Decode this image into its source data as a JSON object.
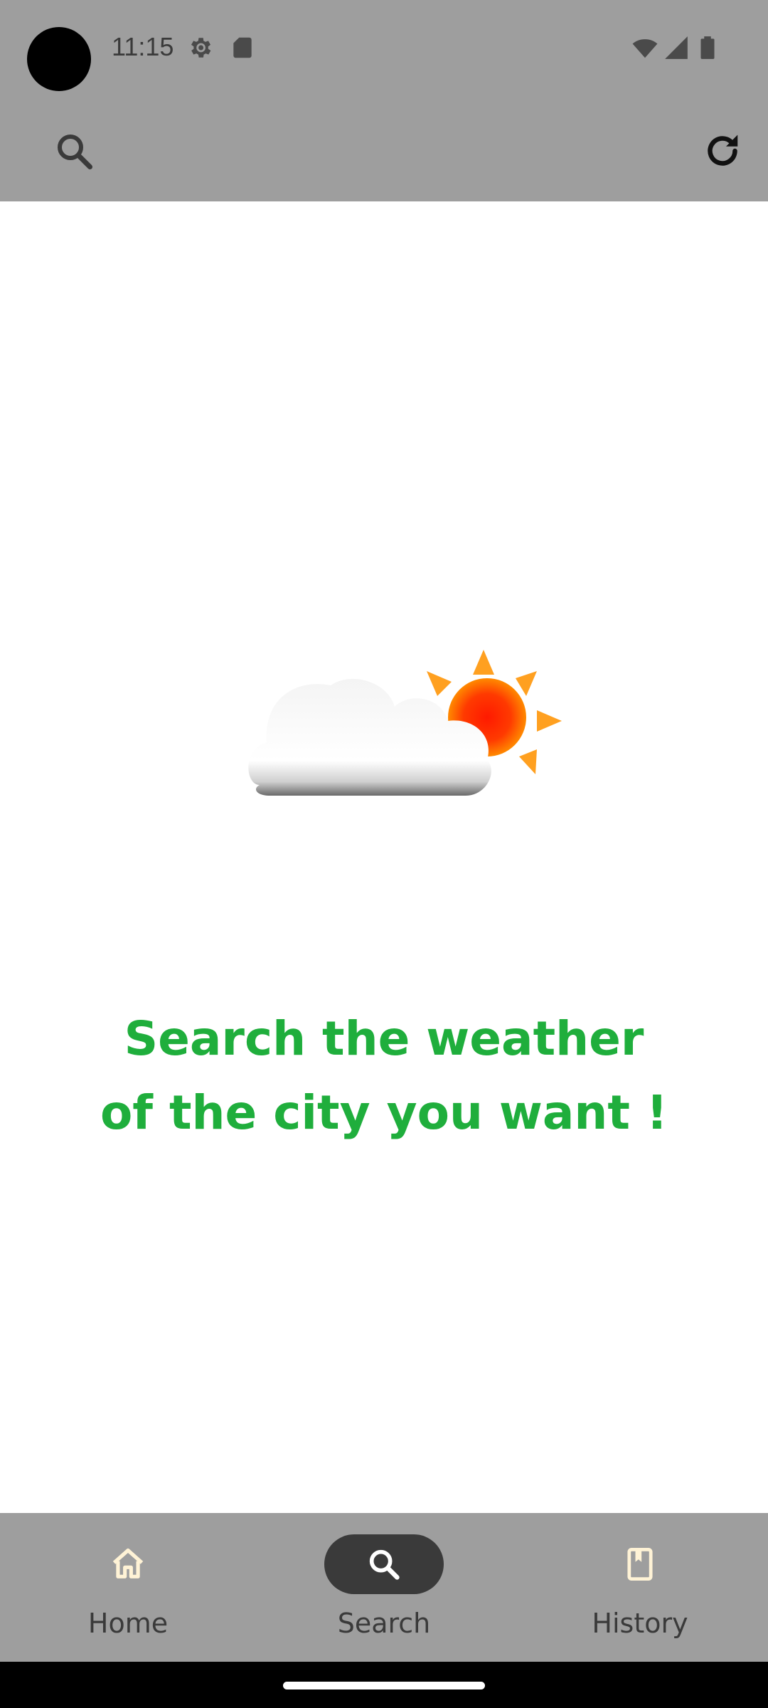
{
  "status_bar": {
    "time": "11:15",
    "icons": [
      "settings-gear-icon",
      "sd-card-icon",
      "wifi-icon",
      "cellular-signal-icon",
      "battery-icon"
    ]
  },
  "app_bar": {
    "left_icon": "search-icon",
    "right_icon": "refresh-icon"
  },
  "main": {
    "illustration": "partly-cloudy-icon",
    "prompt_line1": "Search the weather",
    "prompt_line2": "of the city you want !"
  },
  "bottom_nav": {
    "items": [
      {
        "label": "Home",
        "icon": "home-icon",
        "active": false
      },
      {
        "label": "Search",
        "icon": "search-icon",
        "active": true
      },
      {
        "label": "History",
        "icon": "bookmark-icon",
        "active": false
      }
    ]
  },
  "colors": {
    "bar_background": "#9e9e9e",
    "prompt_text": "#1fae3c",
    "active_pill": "#3a3a3a",
    "nav_icon_active": "#ffffff",
    "nav_icon_inactive": "#fff3d6"
  }
}
